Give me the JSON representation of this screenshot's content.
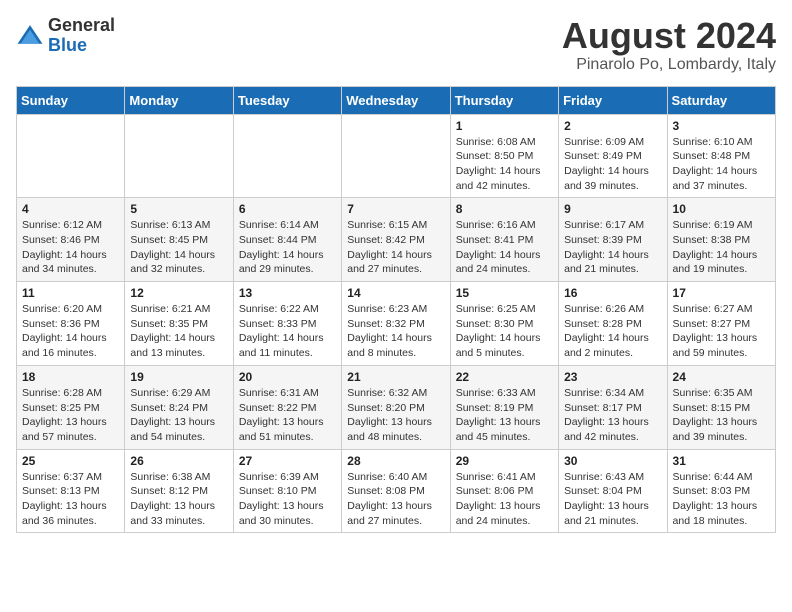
{
  "header": {
    "logo_line1": "General",
    "logo_line2": "Blue",
    "month_title": "August 2024",
    "location": "Pinarolo Po, Lombardy, Italy"
  },
  "weekdays": [
    "Sunday",
    "Monday",
    "Tuesday",
    "Wednesday",
    "Thursday",
    "Friday",
    "Saturday"
  ],
  "weeks": [
    [
      {
        "day": "",
        "info": ""
      },
      {
        "day": "",
        "info": ""
      },
      {
        "day": "",
        "info": ""
      },
      {
        "day": "",
        "info": ""
      },
      {
        "day": "1",
        "info": "Sunrise: 6:08 AM\nSunset: 8:50 PM\nDaylight: 14 hours\nand 42 minutes."
      },
      {
        "day": "2",
        "info": "Sunrise: 6:09 AM\nSunset: 8:49 PM\nDaylight: 14 hours\nand 39 minutes."
      },
      {
        "day": "3",
        "info": "Sunrise: 6:10 AM\nSunset: 8:48 PM\nDaylight: 14 hours\nand 37 minutes."
      }
    ],
    [
      {
        "day": "4",
        "info": "Sunrise: 6:12 AM\nSunset: 8:46 PM\nDaylight: 14 hours\nand 34 minutes."
      },
      {
        "day": "5",
        "info": "Sunrise: 6:13 AM\nSunset: 8:45 PM\nDaylight: 14 hours\nand 32 minutes."
      },
      {
        "day": "6",
        "info": "Sunrise: 6:14 AM\nSunset: 8:44 PM\nDaylight: 14 hours\nand 29 minutes."
      },
      {
        "day": "7",
        "info": "Sunrise: 6:15 AM\nSunset: 8:42 PM\nDaylight: 14 hours\nand 27 minutes."
      },
      {
        "day": "8",
        "info": "Sunrise: 6:16 AM\nSunset: 8:41 PM\nDaylight: 14 hours\nand 24 minutes."
      },
      {
        "day": "9",
        "info": "Sunrise: 6:17 AM\nSunset: 8:39 PM\nDaylight: 14 hours\nand 21 minutes."
      },
      {
        "day": "10",
        "info": "Sunrise: 6:19 AM\nSunset: 8:38 PM\nDaylight: 14 hours\nand 19 minutes."
      }
    ],
    [
      {
        "day": "11",
        "info": "Sunrise: 6:20 AM\nSunset: 8:36 PM\nDaylight: 14 hours\nand 16 minutes."
      },
      {
        "day": "12",
        "info": "Sunrise: 6:21 AM\nSunset: 8:35 PM\nDaylight: 14 hours\nand 13 minutes."
      },
      {
        "day": "13",
        "info": "Sunrise: 6:22 AM\nSunset: 8:33 PM\nDaylight: 14 hours\nand 11 minutes."
      },
      {
        "day": "14",
        "info": "Sunrise: 6:23 AM\nSunset: 8:32 PM\nDaylight: 14 hours\nand 8 minutes."
      },
      {
        "day": "15",
        "info": "Sunrise: 6:25 AM\nSunset: 8:30 PM\nDaylight: 14 hours\nand 5 minutes."
      },
      {
        "day": "16",
        "info": "Sunrise: 6:26 AM\nSunset: 8:28 PM\nDaylight: 14 hours\nand 2 minutes."
      },
      {
        "day": "17",
        "info": "Sunrise: 6:27 AM\nSunset: 8:27 PM\nDaylight: 13 hours\nand 59 minutes."
      }
    ],
    [
      {
        "day": "18",
        "info": "Sunrise: 6:28 AM\nSunset: 8:25 PM\nDaylight: 13 hours\nand 57 minutes."
      },
      {
        "day": "19",
        "info": "Sunrise: 6:29 AM\nSunset: 8:24 PM\nDaylight: 13 hours\nand 54 minutes."
      },
      {
        "day": "20",
        "info": "Sunrise: 6:31 AM\nSunset: 8:22 PM\nDaylight: 13 hours\nand 51 minutes."
      },
      {
        "day": "21",
        "info": "Sunrise: 6:32 AM\nSunset: 8:20 PM\nDaylight: 13 hours\nand 48 minutes."
      },
      {
        "day": "22",
        "info": "Sunrise: 6:33 AM\nSunset: 8:19 PM\nDaylight: 13 hours\nand 45 minutes."
      },
      {
        "day": "23",
        "info": "Sunrise: 6:34 AM\nSunset: 8:17 PM\nDaylight: 13 hours\nand 42 minutes."
      },
      {
        "day": "24",
        "info": "Sunrise: 6:35 AM\nSunset: 8:15 PM\nDaylight: 13 hours\nand 39 minutes."
      }
    ],
    [
      {
        "day": "25",
        "info": "Sunrise: 6:37 AM\nSunset: 8:13 PM\nDaylight: 13 hours\nand 36 minutes."
      },
      {
        "day": "26",
        "info": "Sunrise: 6:38 AM\nSunset: 8:12 PM\nDaylight: 13 hours\nand 33 minutes."
      },
      {
        "day": "27",
        "info": "Sunrise: 6:39 AM\nSunset: 8:10 PM\nDaylight: 13 hours\nand 30 minutes."
      },
      {
        "day": "28",
        "info": "Sunrise: 6:40 AM\nSunset: 8:08 PM\nDaylight: 13 hours\nand 27 minutes."
      },
      {
        "day": "29",
        "info": "Sunrise: 6:41 AM\nSunset: 8:06 PM\nDaylight: 13 hours\nand 24 minutes."
      },
      {
        "day": "30",
        "info": "Sunrise: 6:43 AM\nSunset: 8:04 PM\nDaylight: 13 hours\nand 21 minutes."
      },
      {
        "day": "31",
        "info": "Sunrise: 6:44 AM\nSunset: 8:03 PM\nDaylight: 13 hours\nand 18 minutes."
      }
    ]
  ]
}
